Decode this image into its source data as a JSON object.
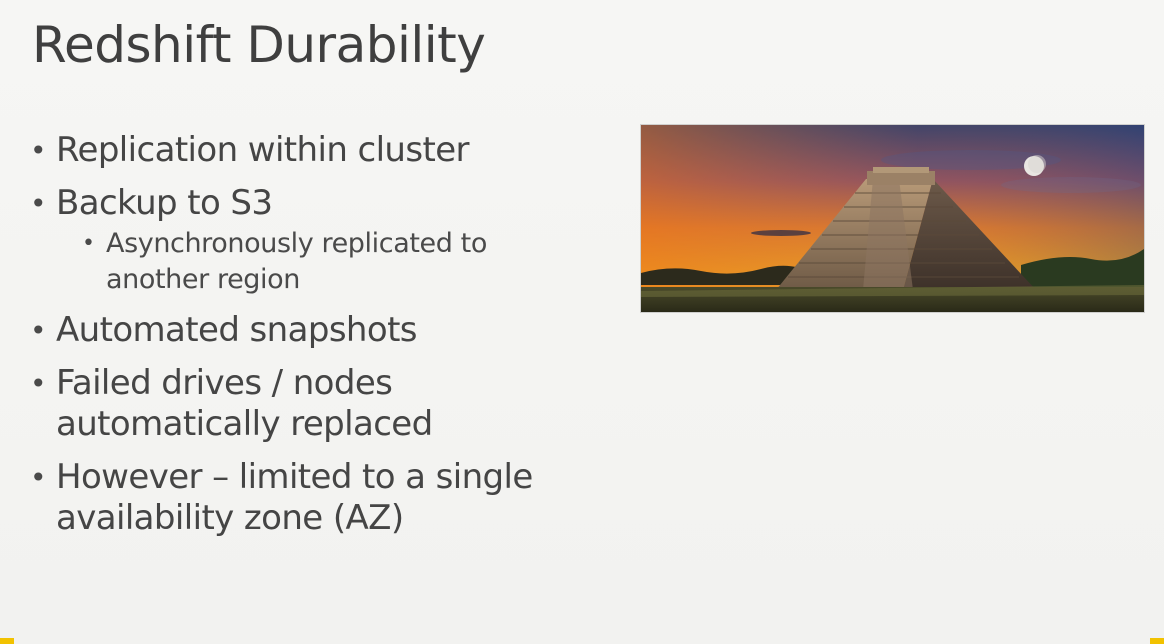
{
  "slide": {
    "title": "Redshift Durability",
    "bullets": [
      {
        "text": "Replication within cluster",
        "sub": []
      },
      {
        "text": "Backup to S3",
        "sub": [
          "Asynchronously replicated to another region"
        ]
      },
      {
        "text": "Automated snapshots",
        "sub": []
      },
      {
        "text": "Failed drives / nodes automatically replaced",
        "sub": []
      },
      {
        "text": "However – limited to a single availability zone (AZ)",
        "sub": []
      }
    ],
    "image": {
      "subject": "pyramid-at-sunset-icon",
      "sky_top": "#2c3d6e",
      "sky_mid": "#e07b2a",
      "sky_low": "#f3a51c",
      "accent": "#f2c200"
    }
  }
}
